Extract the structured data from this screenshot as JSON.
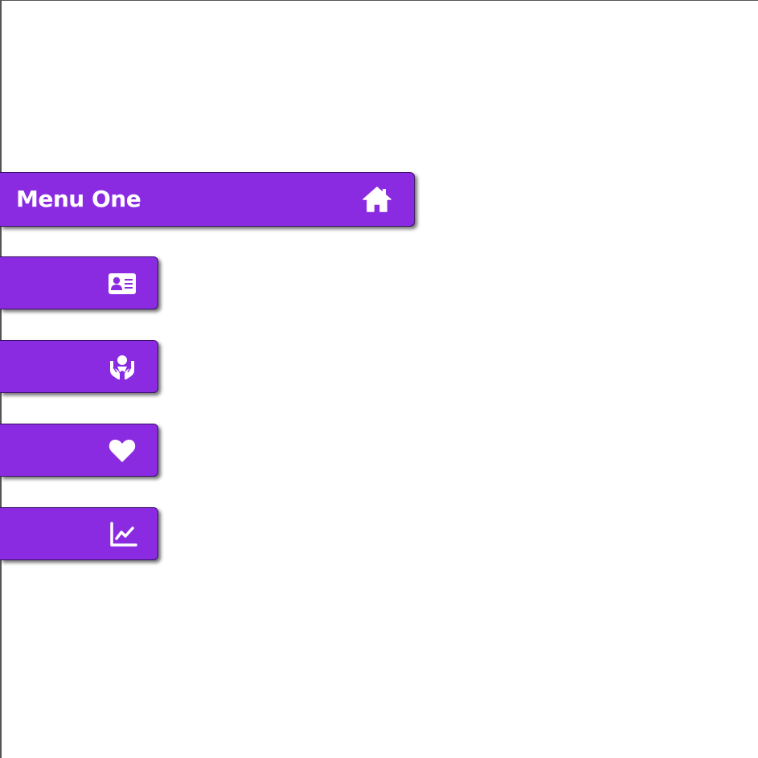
{
  "menu": {
    "accent_color": "#8a2be2",
    "items": [
      {
        "label": "Menu One",
        "icon": "home-icon",
        "expanded": true
      },
      {
        "label": "",
        "icon": "id-card-icon",
        "expanded": false
      },
      {
        "label": "",
        "icon": "hands-holding-person-icon",
        "expanded": false
      },
      {
        "label": "",
        "icon": "heart-icon",
        "expanded": false
      },
      {
        "label": "",
        "icon": "line-chart-icon",
        "expanded": false
      }
    ]
  }
}
